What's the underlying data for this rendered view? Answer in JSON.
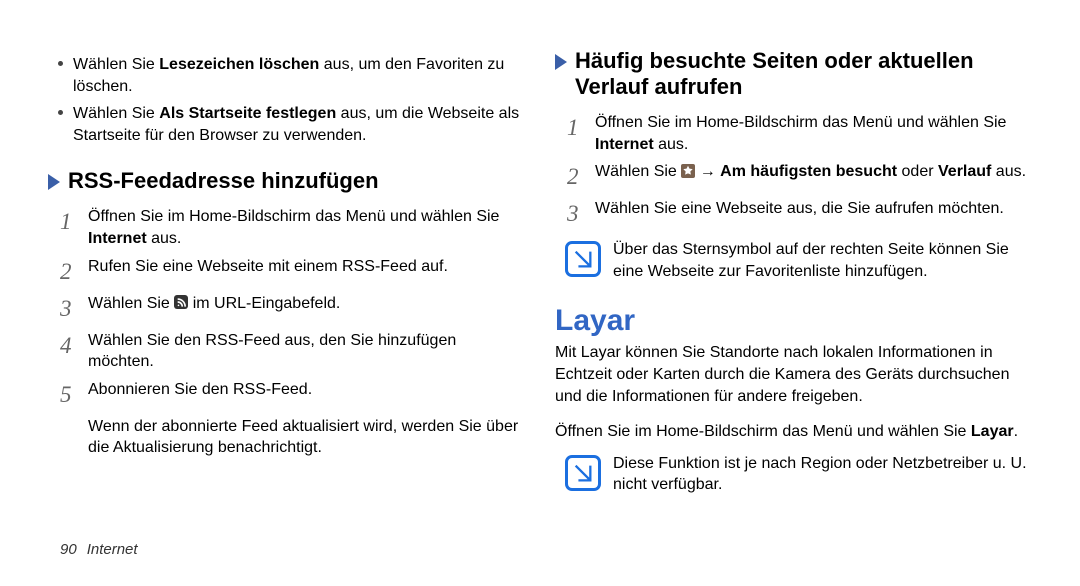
{
  "left": {
    "bullets": [
      {
        "pre": "Wählen Sie ",
        "bold": "Lesezeichen löschen",
        "post": " aus, um den Favoriten zu löschen."
      },
      {
        "pre": "Wählen Sie ",
        "bold": "Als Startseite festlegen",
        "post": " aus, um die Webseite als Startseite für den Browser zu verwenden."
      }
    ],
    "subheading": "RSS-Feedadresse hinzufügen",
    "steps": {
      "s1_pre": "Öffnen Sie im Home-Bildschirm das Menü und wählen Sie ",
      "s1_bold": "Internet",
      "s1_post": " aus.",
      "s2": "Rufen Sie eine Webseite mit einem RSS-Feed auf.",
      "s3_pre": "Wählen Sie ",
      "s3_post": " im URL-Eingabefeld.",
      "s4": "Wählen Sie den RSS-Feed aus, den Sie hinzufügen möchten.",
      "s5": "Abonnieren Sie den RSS-Feed.",
      "after": "Wenn der abonnierte Feed aktualisiert wird, werden Sie über die Aktualisierung benachrichtigt."
    }
  },
  "right": {
    "subheading": "Häufig besuchte Seiten oder aktuellen Verlauf aufrufen",
    "steps": {
      "s1_pre": "Öffnen Sie im Home-Bildschirm das Menü und wählen Sie ",
      "s1_bold": "Internet",
      "s1_post": " aus.",
      "s2_pre": "Wählen Sie ",
      "s2_arrow": " → ",
      "s2_bold1": "Am häufigsten besucht",
      "s2_mid": " oder ",
      "s2_bold2": "Verlauf",
      "s2_post": " aus.",
      "s3": "Wählen Sie eine Webseite aus, die Sie aufrufen möchten."
    },
    "note1": "Über das Sternsymbol auf der rechten Seite können Sie eine Webseite zur Favoritenliste hinzufügen.",
    "section_title": "Layar",
    "section_desc": "Mit Layar können Sie Standorte nach lokalen Informationen in Echtzeit oder Karten durch die Kamera des Geräts durchsuchen und die Informationen für andere freigeben.",
    "section_open_pre": "Öffnen Sie im Home-Bildschirm das Menü und wählen Sie ",
    "section_open_bold": "Layar",
    "section_open_post": ".",
    "note2": "Diese Funktion ist je nach Region oder Netzbetreiber u. U. nicht verfügbar."
  },
  "nums": {
    "n1": "1",
    "n2": "2",
    "n3": "3",
    "n4": "4",
    "n5": "5"
  },
  "footer": {
    "page": "90",
    "section": "Internet"
  }
}
